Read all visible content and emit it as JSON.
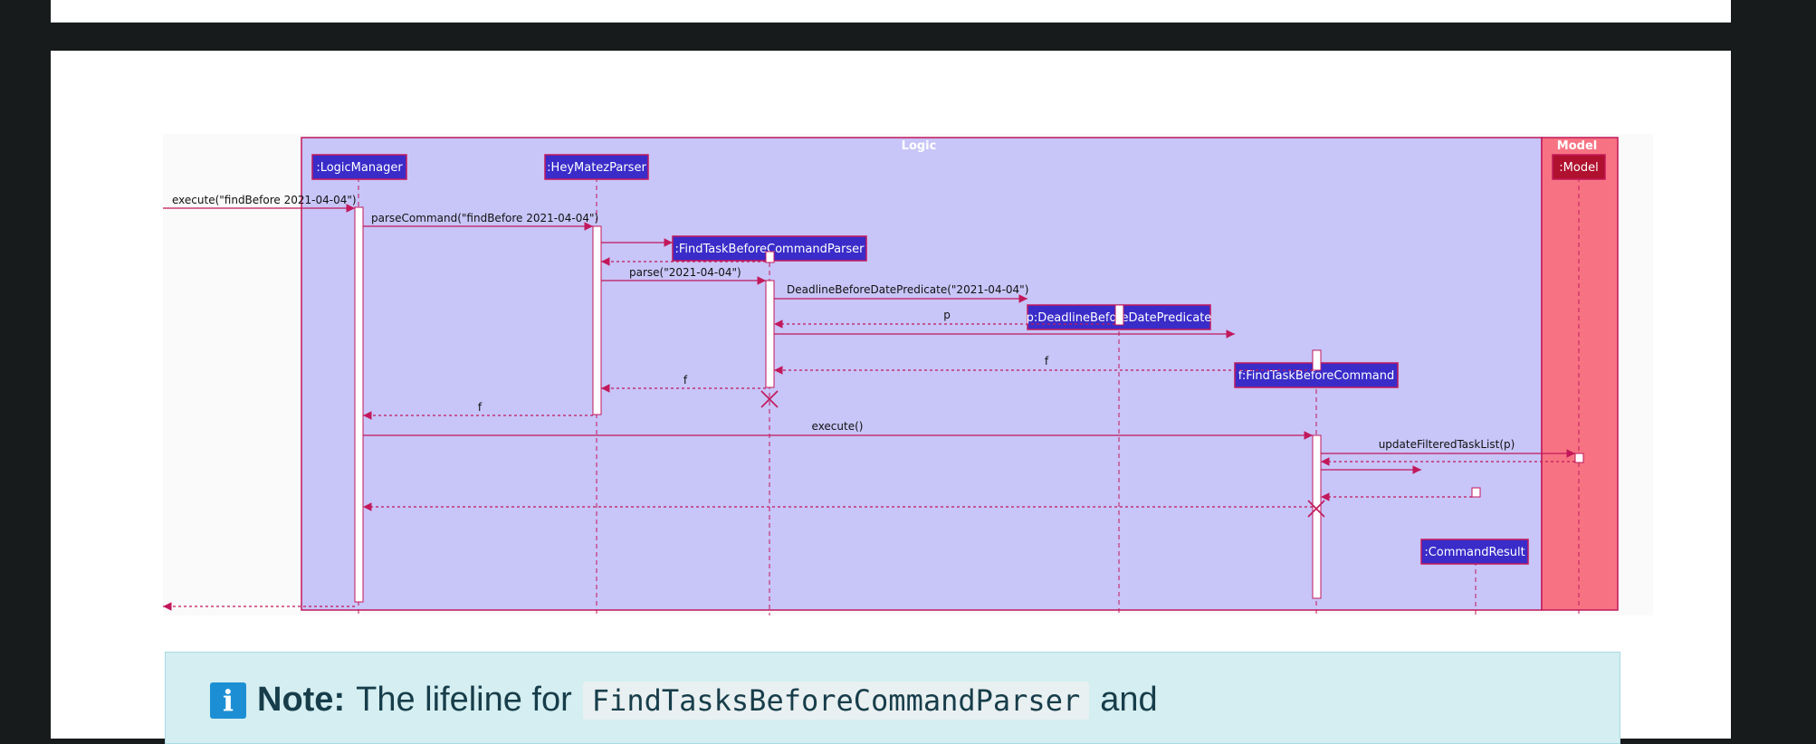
{
  "diagram": {
    "frames": {
      "logic": "Logic",
      "model": "Model"
    },
    "participants": {
      "logic_manager": ":LogicManager",
      "parser": ":HeyMatezParser",
      "cmd_parser": ":FindTaskBeforeCommandParser",
      "predicate": "p:DeadlineBeforeDatePredicate",
      "command": "f:FindTaskBeforeCommand",
      "result": ":CommandResult",
      "model": ":Model"
    },
    "messages": {
      "m1": "execute(\"findBefore 2021-04-04\")",
      "m2": "parseCommand(\"findBefore 2021-04-04\")",
      "m3": "parse(\"2021-04-04\")",
      "m4": "DeadlineBeforeDatePredicate(\"2021-04-04\")",
      "m5": "p",
      "m6": "f",
      "m7": "f",
      "m8": "f",
      "m9": "execute()",
      "m10": "updateFilteredTaskList(p)"
    },
    "colors": {
      "frame_fill": "#c8c5f8",
      "frame_border": "#c2185b",
      "participant_fill": "#3a2cc9",
      "model_frame_fill": "#f77383",
      "model_box_fill": "#b0112e",
      "arrow": "#c2185b"
    }
  },
  "note": {
    "icon": "info-icon",
    "label": "Note:",
    "text_before": "The lifeline for",
    "code": "FindTasksBeforeCommandParser",
    "text_after": "and"
  }
}
